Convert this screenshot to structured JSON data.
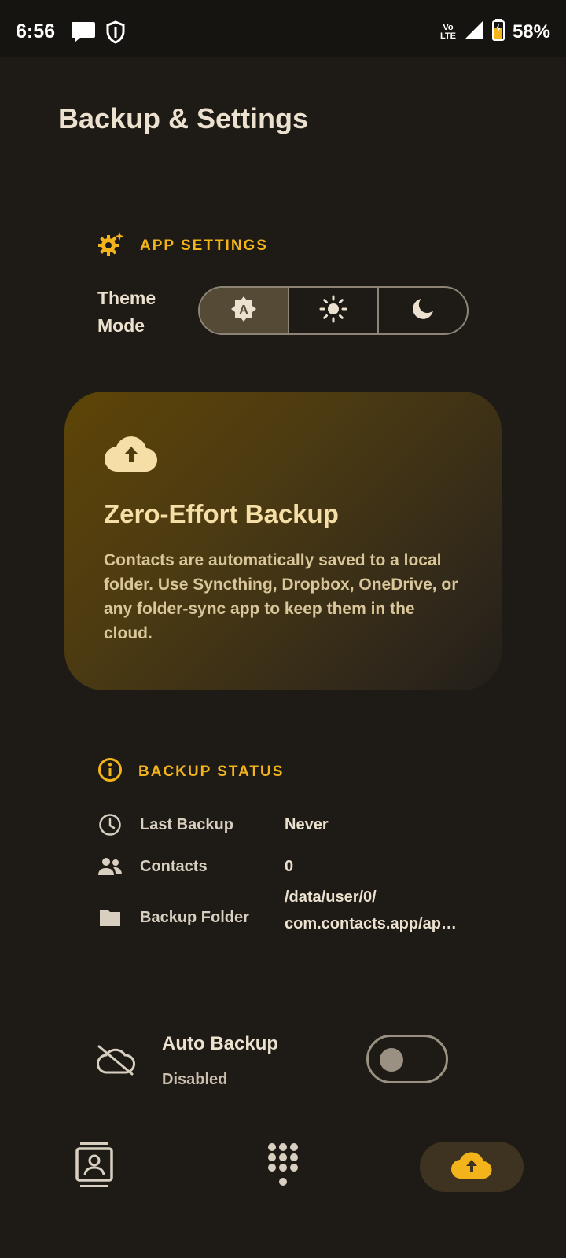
{
  "status_bar": {
    "time": "6:56",
    "network_label_top": "Vo",
    "network_label_bottom": "LTE",
    "battery": "58%"
  },
  "page": {
    "title": "Backup & Settings"
  },
  "app_settings": {
    "section_label": "APP SETTINGS",
    "theme_label": "Theme Mode",
    "theme_options": [
      {
        "name": "auto",
        "icon": "auto-brightness-icon",
        "selected": true
      },
      {
        "name": "light",
        "icon": "sun-icon",
        "selected": false
      },
      {
        "name": "dark",
        "icon": "moon-icon",
        "selected": false
      }
    ]
  },
  "promo_card": {
    "icon": "cloud-upload-icon",
    "title": "Zero-Effort Backup",
    "body": "Contacts are automatically saved to a local folder. Use Syncthing, Dropbox, OneDrive, or any folder-sync app to keep them in the cloud."
  },
  "backup_status": {
    "section_label": "BACKUP STATUS",
    "rows": [
      {
        "label": "Last Backup",
        "value": "Never",
        "icon": "clock-icon"
      },
      {
        "label": "Contacts",
        "value": "0",
        "icon": "people-icon"
      },
      {
        "label": "Backup Folder",
        "value_line1": "/data/user/0/",
        "value_line2": "com.contacts.app/ap…",
        "icon": "folder-icon"
      }
    ]
  },
  "auto_backup": {
    "title": "Auto Backup",
    "subtitle": "Disabled",
    "enabled": false,
    "icon": "cloud-off-icon"
  },
  "bottom_nav": {
    "items": [
      {
        "name": "contacts",
        "icon": "contact-card-icon",
        "active": false
      },
      {
        "name": "dialpad",
        "icon": "dialpad-icon",
        "active": false
      },
      {
        "name": "backup",
        "icon": "cloud-upload-icon",
        "active": true
      }
    ]
  },
  "colors": {
    "background": "#1e1b16",
    "accent": "#f3b41b",
    "card_start": "#5e4507",
    "text": "#ece1cf"
  }
}
